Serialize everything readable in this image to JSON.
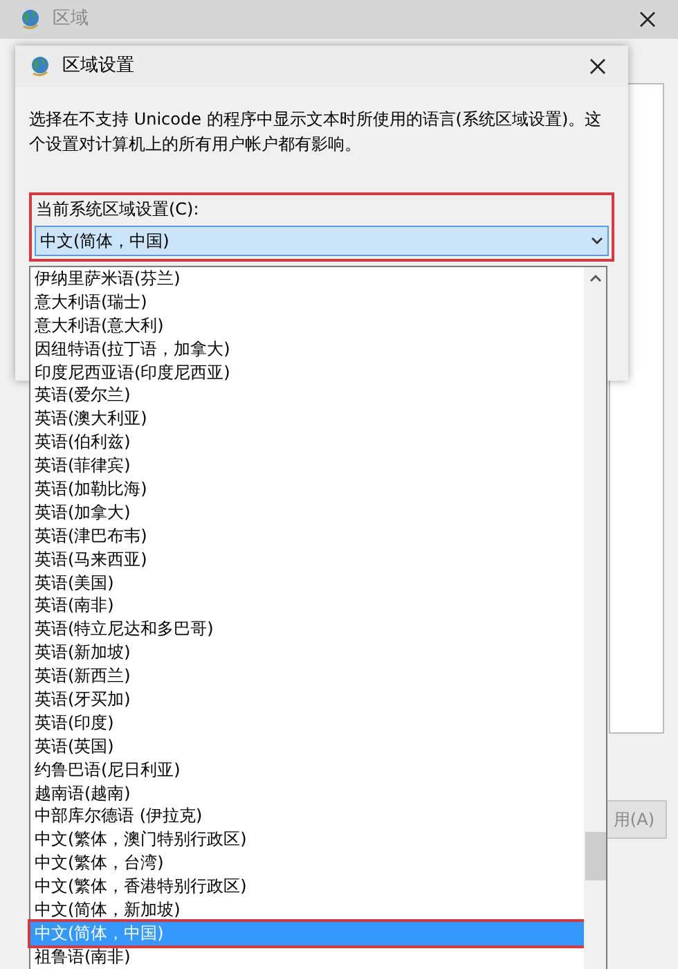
{
  "background_window": {
    "title": "区域",
    "partial_button": "用(A)"
  },
  "dialog": {
    "title": "区域设置",
    "description": "选择在不支持 Unicode 的程序中显示文本时所使用的语言(系统区域设置)。这个设置对计算机上的所有用户帐户都有影响。",
    "field_label": "当前系统区域设置(C):",
    "combo_value": "中文(简体，中国)"
  },
  "dropdown_items": [
    {
      "label": "伊纳里萨米语(芬兰)",
      "selected": false
    },
    {
      "label": "意大利语(瑞士)",
      "selected": false
    },
    {
      "label": "意大利语(意大利)",
      "selected": false
    },
    {
      "label": "因纽特语(拉丁语，加拿大)",
      "selected": false
    },
    {
      "label": "印度尼西亚语(印度尼西亚)",
      "selected": false
    },
    {
      "label": "英语(爱尔兰)",
      "selected": false
    },
    {
      "label": "英语(澳大利亚)",
      "selected": false
    },
    {
      "label": "英语(伯利兹)",
      "selected": false
    },
    {
      "label": "英语(菲律宾)",
      "selected": false
    },
    {
      "label": "英语(加勒比海)",
      "selected": false
    },
    {
      "label": "英语(加拿大)",
      "selected": false
    },
    {
      "label": "英语(津巴布韦)",
      "selected": false
    },
    {
      "label": "英语(马来西亚)",
      "selected": false
    },
    {
      "label": "英语(美国)",
      "selected": false
    },
    {
      "label": "英语(南非)",
      "selected": false
    },
    {
      "label": "英语(特立尼达和多巴哥)",
      "selected": false
    },
    {
      "label": "英语(新加坡)",
      "selected": false
    },
    {
      "label": "英语(新西兰)",
      "selected": false
    },
    {
      "label": "英语(牙买加)",
      "selected": false
    },
    {
      "label": "英语(印度)",
      "selected": false
    },
    {
      "label": "英语(英国)",
      "selected": false
    },
    {
      "label": "约鲁巴语(尼日利亚)",
      "selected": false
    },
    {
      "label": "越南语(越南)",
      "selected": false
    },
    {
      "label": "中部库尔德语 (伊拉克)",
      "selected": false
    },
    {
      "label": "中文(繁体，澳门特别行政区)",
      "selected": false
    },
    {
      "label": "中文(繁体，台湾)",
      "selected": false
    },
    {
      "label": "中文(繁体，香港特别行政区)",
      "selected": false
    },
    {
      "label": "中文(简体，新加坡)",
      "selected": false
    },
    {
      "label": "中文(简体，中国)",
      "selected": true
    },
    {
      "label": "祖鲁语(南非)",
      "selected": false
    }
  ]
}
